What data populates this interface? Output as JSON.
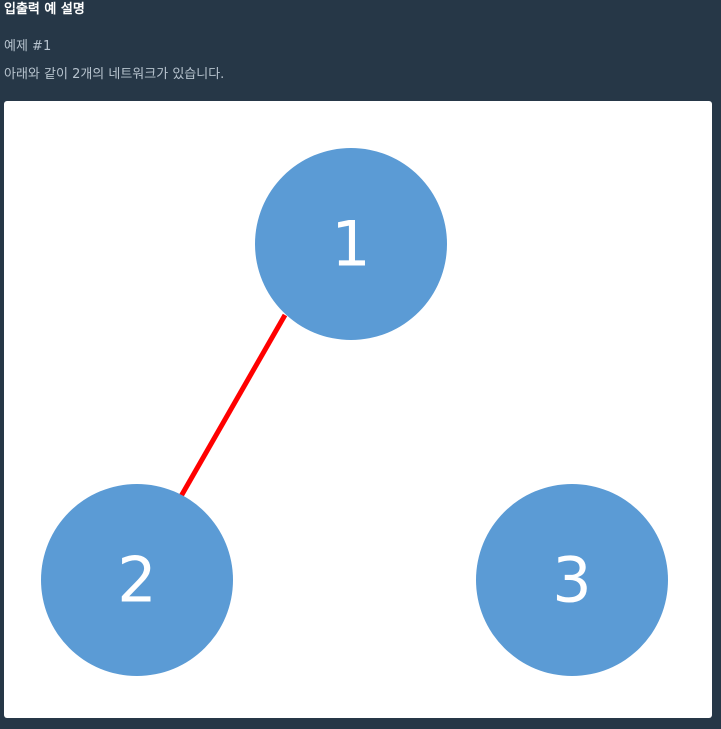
{
  "section": {
    "title": "입출력 예 설명"
  },
  "example": {
    "title": "예제 #1",
    "description": "아래와 같이 2개의 네트워크가 있습니다."
  },
  "diagram": {
    "node_color": "#5b9bd5",
    "edge_color": "#ff0000",
    "nodes": [
      {
        "id": "1",
        "label": "1"
      },
      {
        "id": "2",
        "label": "2"
      },
      {
        "id": "3",
        "label": "3"
      }
    ],
    "edges": [
      {
        "from": "1",
        "to": "2"
      }
    ]
  }
}
